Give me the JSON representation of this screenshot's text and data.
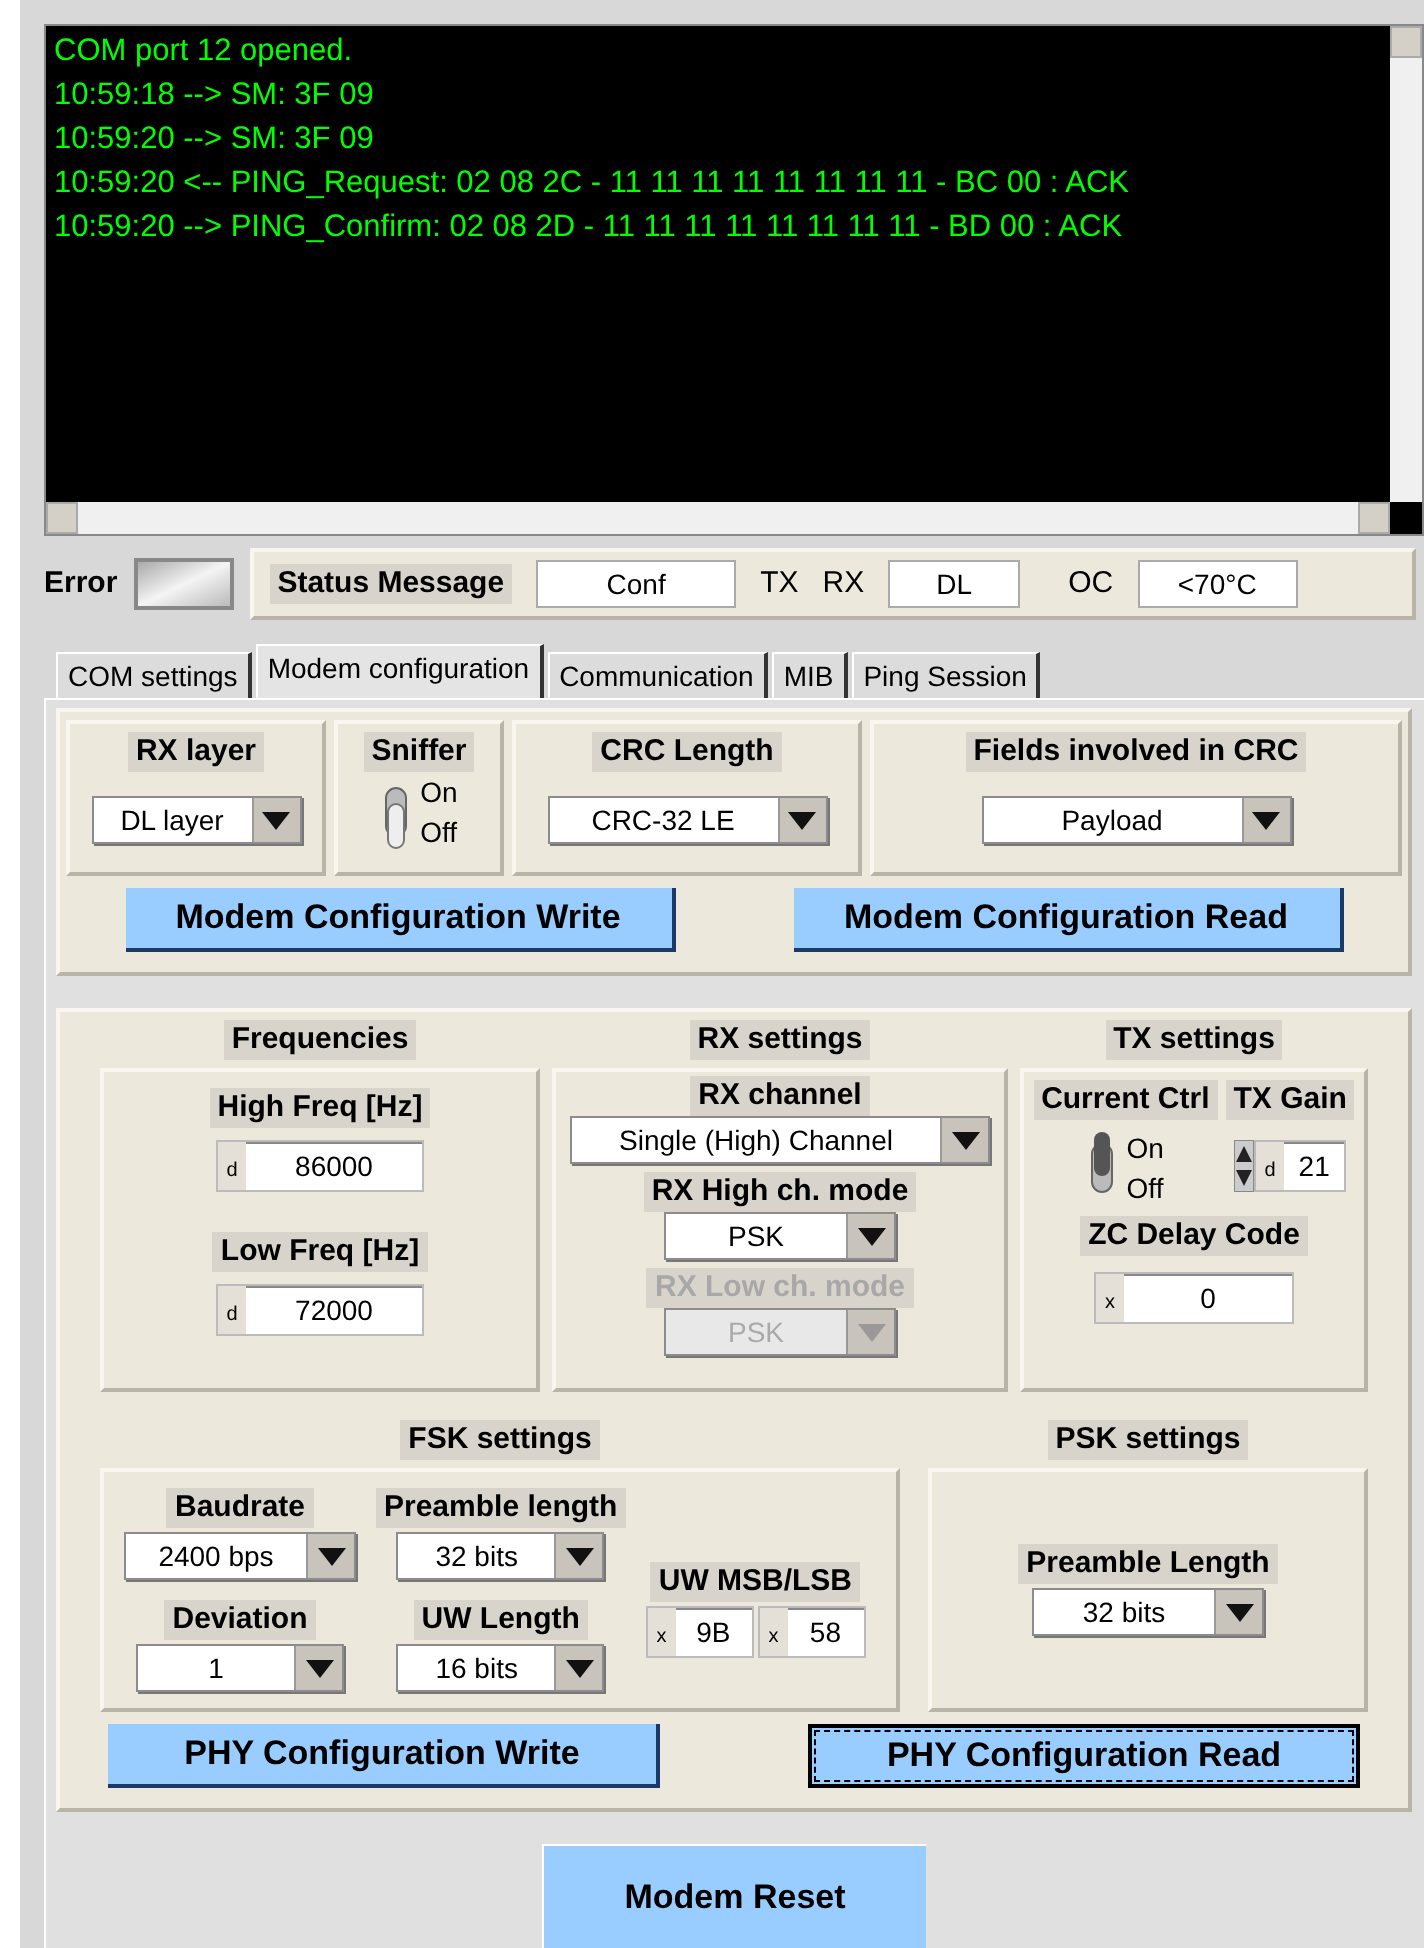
{
  "console": {
    "lines": [
      "COM port 12 opened.",
      "10:59:18 --> SM: 3F 09",
      "10:59:20 --> SM: 3F 09",
      "10:59:20 <-- PING_Request: 02 08 2C - 11 11 11 11 11 11 11 11 - BC 00 : ACK",
      "10:59:20 --> PING_Confirm: 02 08 2D - 11 11 11 11 11 11 11 11 - BD 00 : ACK"
    ]
  },
  "status": {
    "error_label": "Error",
    "error_lit": false,
    "message_label": "Status Message",
    "message_value": "Conf",
    "tx_label": "TX",
    "rx_label": "RX",
    "rx_value": "DL",
    "oc_label": "OC",
    "oc_value": "<70°C"
  },
  "tabs": [
    {
      "label": "COM settings",
      "selected": false
    },
    {
      "label": "Modem configuration",
      "selected": true
    },
    {
      "label": "Communication",
      "selected": false
    },
    {
      "label": "MIB",
      "selected": false
    },
    {
      "label": "Ping Session",
      "selected": false
    }
  ],
  "modem_config": {
    "rx_layer": {
      "label": "RX layer",
      "value": "DL layer"
    },
    "sniffer": {
      "label": "Sniffer",
      "on_label": "On",
      "off_label": "Off",
      "on": false
    },
    "crc_length": {
      "label": "CRC Length",
      "value": "CRC-32  LE"
    },
    "crc_fields": {
      "label": "Fields involved in CRC",
      "value": "Payload"
    },
    "buttons": [
      {
        "label": "Modem Configuration Write",
        "focused": false
      },
      {
        "label": "Modem Configuration Read",
        "focused": false
      }
    ]
  },
  "phy": {
    "frequencies": {
      "title": "Frequencies",
      "high": {
        "label": "High Freq [Hz]",
        "radix": "d",
        "value": "86000"
      },
      "low": {
        "label": "Low Freq [Hz]",
        "radix": "d",
        "value": "72000"
      }
    },
    "rx_settings": {
      "title": "RX settings",
      "channel": {
        "label": "RX channel",
        "value": "Single (High) Channel",
        "disabled": false
      },
      "high_mode": {
        "label": "RX High ch. mode",
        "value": "PSK",
        "disabled": false
      },
      "low_mode": {
        "label": "RX Low ch. mode",
        "value": "PSK",
        "disabled": true
      }
    },
    "tx_settings": {
      "title": "TX settings",
      "current_ctrl": {
        "label": "Current Ctrl",
        "on_label": "On",
        "off_label": "Off",
        "on": true
      },
      "tx_gain": {
        "label": "TX Gain",
        "radix": "d",
        "value": "21"
      },
      "zc_delay": {
        "label": "ZC Delay Code",
        "radix": "x",
        "value": "0"
      }
    },
    "fsk": {
      "title": "FSK settings",
      "baudrate": {
        "label": "Baudrate",
        "value": "2400 bps"
      },
      "preamble": {
        "label": "Preamble length",
        "value": "32 bits"
      },
      "deviation": {
        "label": "Deviation",
        "value": "1"
      },
      "uw_length": {
        "label": "UW Length",
        "value": "16 bits"
      },
      "uw": {
        "label": "UW MSB/LSB",
        "msb": {
          "radix": "x",
          "value": "9B"
        },
        "lsb": {
          "radix": "x",
          "value": "58"
        }
      }
    },
    "psk": {
      "title": "PSK settings",
      "preamble": {
        "label": "Preamble Length",
        "value": "32 bits"
      }
    },
    "buttons": [
      {
        "label": "PHY Configuration Write",
        "focused": false
      },
      {
        "label": "PHY Configuration Read",
        "focused": true
      }
    ]
  },
  "reset_button": {
    "label": "Modem Reset"
  }
}
